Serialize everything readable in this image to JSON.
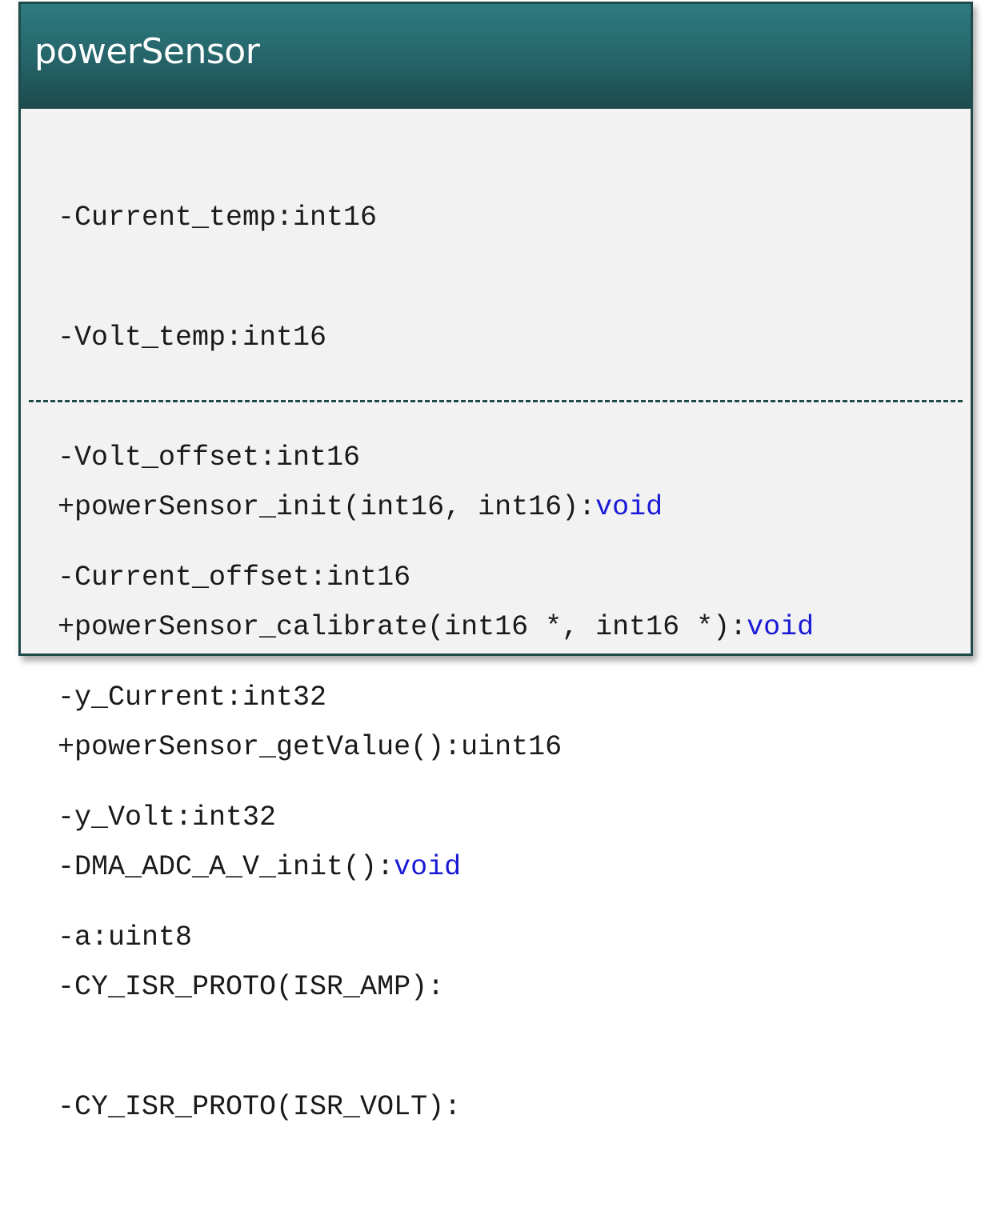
{
  "diagram": {
    "class_name": "powerSensor",
    "attributes": [
      "-Current_temp:int16",
      "-Volt_temp:int16",
      "-Volt_offset:int16",
      "-Current_offset:int16",
      "-y_Current:int32",
      "-y_Volt:int32",
      "-a:uint8"
    ],
    "operations": [
      {
        "signature": "+powerSensor_init(int16, int16):",
        "return_type": "void"
      },
      {
        "signature": "+powerSensor_calibrate(int16 *, int16 *):",
        "return_type": "void"
      },
      {
        "signature": "+powerSensor_getValue():uint16",
        "return_type": ""
      },
      {
        "signature": "-DMA_ADC_A_V_init():",
        "return_type": "void"
      },
      {
        "signature": "-CY_ISR_PROTO(ISR_AMP):",
        "return_type": ""
      },
      {
        "signature": "-CY_ISR_PROTO(ISR_VOLT):",
        "return_type": ""
      }
    ]
  },
  "colors": {
    "header": "#256469",
    "border": "#1f4a4a",
    "body": "#f2f2f2",
    "keyword": "#1a1ad6"
  }
}
